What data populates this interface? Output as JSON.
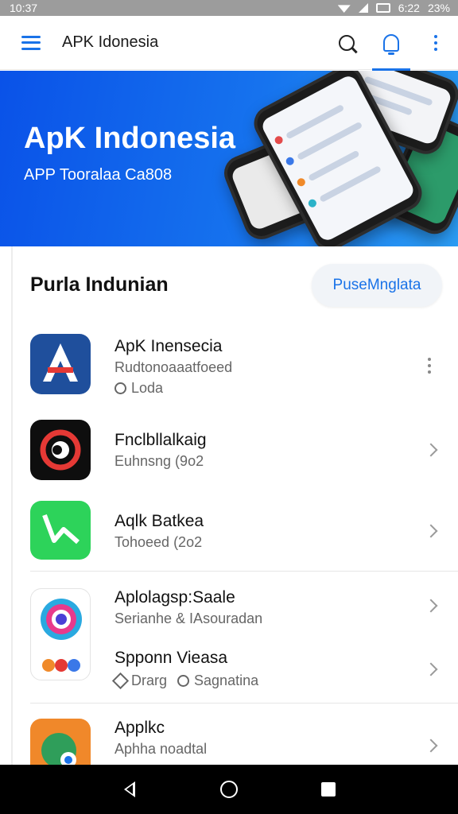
{
  "status_bar": {
    "time_left": "10:37",
    "time_right": "6:22",
    "battery": "23%"
  },
  "app_bar": {
    "title": "APK Idonesia",
    "menu_icon": "hamburger-menu-icon",
    "search_icon": "search-icon",
    "notifications_icon": "bell-icon",
    "more_icon": "more-vertical-icon",
    "accent": "#1a73e8"
  },
  "banner": {
    "title": "ApK Indonesia",
    "subtitle": "APP Tooralaa Ca808",
    "colors": [
      "#0a52e8",
      "#2b9cf3"
    ]
  },
  "section": {
    "title": "Purla Indunian",
    "action_label": "PuseMnglata"
  },
  "apps": [
    {
      "name": "ApK Inensecia",
      "subtitle": "Rudtonoaaatfoeed",
      "meta": "Loda",
      "trailing": "more"
    },
    {
      "name": "Fnclbllalkaig",
      "subtitle": "Euhnsng (9o2",
      "trailing": "chevron"
    },
    {
      "name": "Aqlk Batkea",
      "subtitle": "Tohoeed (2o2",
      "trailing": "chevron"
    },
    {
      "name": "Aplolagsp:Saale",
      "subtitle": "Serianhe & IAsouradan",
      "trailing": "chevron"
    },
    {
      "name": "Spponn Vieasa",
      "meta_a": "Drarg",
      "meta_b": "Sagnatina",
      "trailing": "chevron"
    },
    {
      "name": "Applkc",
      "subtitle": "Aphha noadtal",
      "trailing": "chevron"
    }
  ],
  "nav_bar": {
    "back_icon": "back-icon",
    "home_icon": "home-icon",
    "recents_icon": "recents-icon"
  }
}
